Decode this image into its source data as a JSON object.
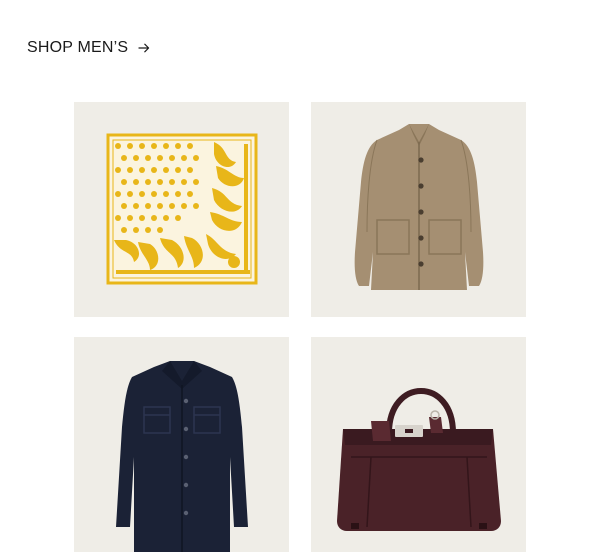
{
  "header": {
    "shop_label": "SHOP MEN’S",
    "arrow_icon": "arrow-right-icon"
  },
  "products": [
    {
      "image": "yellow-paisley-pocket-square",
      "background": "#efede7",
      "accent": "#e8b619"
    },
    {
      "image": "tan-button-front-jacket",
      "background": "#efede7",
      "accent": "#a58f72"
    },
    {
      "image": "navy-shirt-jacket",
      "background": "#efede7",
      "accent": "#1b2236"
    },
    {
      "image": "brown-leather-duffel-bag",
      "background": "#efede7",
      "accent": "#4a2228"
    }
  ]
}
